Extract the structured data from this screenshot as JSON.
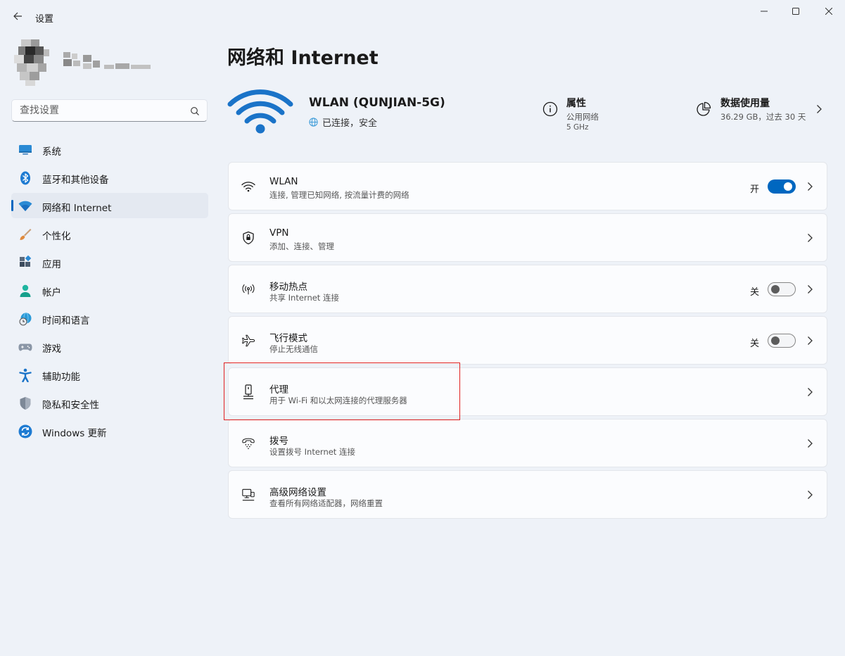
{
  "window": {
    "title": "设置",
    "back_icon": "arrow-left-icon",
    "minimize_icon": "minimize-icon",
    "maximize_icon": "maximize-icon",
    "close_icon": "close-icon"
  },
  "search": {
    "placeholder": "查找设置",
    "icon": "search-icon"
  },
  "sidebar": {
    "items": [
      {
        "label": "系统",
        "icon": "system-display-icon",
        "active": false
      },
      {
        "label": "蓝牙和其他设备",
        "icon": "bluetooth-icon",
        "active": false
      },
      {
        "label": "网络和 Internet",
        "icon": "wifi-icon",
        "active": true
      },
      {
        "label": "个性化",
        "icon": "paintbrush-icon",
        "active": false
      },
      {
        "label": "应用",
        "icon": "apps-icon",
        "active": false
      },
      {
        "label": "帐户",
        "icon": "account-icon",
        "active": false
      },
      {
        "label": "时间和语言",
        "icon": "globe-clock-icon",
        "active": false
      },
      {
        "label": "游戏",
        "icon": "gamepad-icon",
        "active": false
      },
      {
        "label": "辅助功能",
        "icon": "accessibility-icon",
        "active": false
      },
      {
        "label": "隐私和安全性",
        "icon": "shield-icon",
        "active": false
      },
      {
        "label": "Windows 更新",
        "icon": "update-icon",
        "active": false
      }
    ]
  },
  "main": {
    "title": "网络和 Internet",
    "network": {
      "ssid": "WLAN (QUNJIAN-5G)",
      "status": "已连接，安全",
      "properties": {
        "title": "属性",
        "line1": "公用网络",
        "line2": "5 GHz"
      },
      "data_usage": {
        "title": "数据使用量",
        "line1": "36.29 GB，过去 30 天"
      }
    },
    "cards": [
      {
        "title": "WLAN",
        "subtitle": "连接, 管理已知网络, 按流量计费的网络",
        "icon": "wifi-icon",
        "toggle_label": "开",
        "toggle_on": true
      },
      {
        "title": "VPN",
        "subtitle": "添加、连接、管理",
        "icon": "vpn-shield-icon"
      },
      {
        "title": "移动热点",
        "subtitle": "共享 Internet 连接",
        "icon": "hotspot-icon",
        "toggle_label": "关",
        "toggle_on": false
      },
      {
        "title": "飞行模式",
        "subtitle": "停止无线通信",
        "icon": "airplane-icon",
        "toggle_label": "关",
        "toggle_on": false
      },
      {
        "title": "代理",
        "subtitle": "用于 Wi-Fi 和以太网连接的代理服务器",
        "icon": "proxy-icon"
      },
      {
        "title": "拨号",
        "subtitle": "设置拨号 Internet 连接",
        "icon": "dialup-icon"
      },
      {
        "title": "高级网络设置",
        "subtitle": "查看所有网络适配器，网络重置",
        "icon": "advanced-network-icon"
      }
    ]
  },
  "colors": {
    "accent": "#0067c0",
    "background": "#eef2f8",
    "card": "#fbfcfe",
    "highlight": "#e02020"
  }
}
